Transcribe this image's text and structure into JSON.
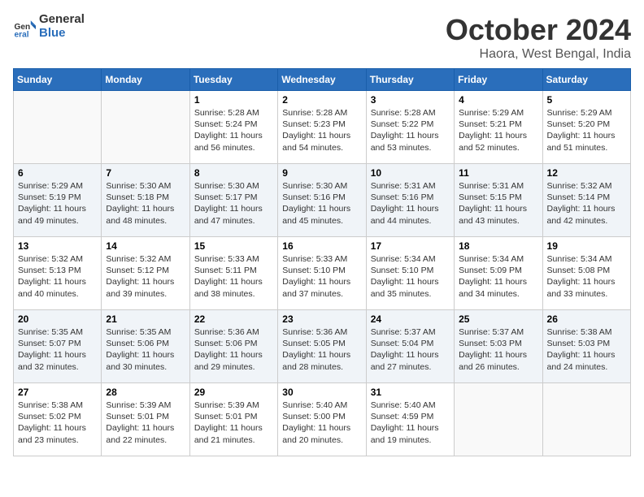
{
  "logo": {
    "line1": "General",
    "line2": "Blue"
  },
  "title": "October 2024",
  "location": "Haora, West Bengal, India",
  "days_of_week": [
    "Sunday",
    "Monday",
    "Tuesday",
    "Wednesday",
    "Thursday",
    "Friday",
    "Saturday"
  ],
  "weeks": [
    [
      {
        "day": "",
        "info": ""
      },
      {
        "day": "",
        "info": ""
      },
      {
        "day": "1",
        "info": "Sunrise: 5:28 AM\nSunset: 5:24 PM\nDaylight: 11 hours and 56 minutes."
      },
      {
        "day": "2",
        "info": "Sunrise: 5:28 AM\nSunset: 5:23 PM\nDaylight: 11 hours and 54 minutes."
      },
      {
        "day": "3",
        "info": "Sunrise: 5:28 AM\nSunset: 5:22 PM\nDaylight: 11 hours and 53 minutes."
      },
      {
        "day": "4",
        "info": "Sunrise: 5:29 AM\nSunset: 5:21 PM\nDaylight: 11 hours and 52 minutes."
      },
      {
        "day": "5",
        "info": "Sunrise: 5:29 AM\nSunset: 5:20 PM\nDaylight: 11 hours and 51 minutes."
      }
    ],
    [
      {
        "day": "6",
        "info": "Sunrise: 5:29 AM\nSunset: 5:19 PM\nDaylight: 11 hours and 49 minutes."
      },
      {
        "day": "7",
        "info": "Sunrise: 5:30 AM\nSunset: 5:18 PM\nDaylight: 11 hours and 48 minutes."
      },
      {
        "day": "8",
        "info": "Sunrise: 5:30 AM\nSunset: 5:17 PM\nDaylight: 11 hours and 47 minutes."
      },
      {
        "day": "9",
        "info": "Sunrise: 5:30 AM\nSunset: 5:16 PM\nDaylight: 11 hours and 45 minutes."
      },
      {
        "day": "10",
        "info": "Sunrise: 5:31 AM\nSunset: 5:16 PM\nDaylight: 11 hours and 44 minutes."
      },
      {
        "day": "11",
        "info": "Sunrise: 5:31 AM\nSunset: 5:15 PM\nDaylight: 11 hours and 43 minutes."
      },
      {
        "day": "12",
        "info": "Sunrise: 5:32 AM\nSunset: 5:14 PM\nDaylight: 11 hours and 42 minutes."
      }
    ],
    [
      {
        "day": "13",
        "info": "Sunrise: 5:32 AM\nSunset: 5:13 PM\nDaylight: 11 hours and 40 minutes."
      },
      {
        "day": "14",
        "info": "Sunrise: 5:32 AM\nSunset: 5:12 PM\nDaylight: 11 hours and 39 minutes."
      },
      {
        "day": "15",
        "info": "Sunrise: 5:33 AM\nSunset: 5:11 PM\nDaylight: 11 hours and 38 minutes."
      },
      {
        "day": "16",
        "info": "Sunrise: 5:33 AM\nSunset: 5:10 PM\nDaylight: 11 hours and 37 minutes."
      },
      {
        "day": "17",
        "info": "Sunrise: 5:34 AM\nSunset: 5:10 PM\nDaylight: 11 hours and 35 minutes."
      },
      {
        "day": "18",
        "info": "Sunrise: 5:34 AM\nSunset: 5:09 PM\nDaylight: 11 hours and 34 minutes."
      },
      {
        "day": "19",
        "info": "Sunrise: 5:34 AM\nSunset: 5:08 PM\nDaylight: 11 hours and 33 minutes."
      }
    ],
    [
      {
        "day": "20",
        "info": "Sunrise: 5:35 AM\nSunset: 5:07 PM\nDaylight: 11 hours and 32 minutes."
      },
      {
        "day": "21",
        "info": "Sunrise: 5:35 AM\nSunset: 5:06 PM\nDaylight: 11 hours and 30 minutes."
      },
      {
        "day": "22",
        "info": "Sunrise: 5:36 AM\nSunset: 5:06 PM\nDaylight: 11 hours and 29 minutes."
      },
      {
        "day": "23",
        "info": "Sunrise: 5:36 AM\nSunset: 5:05 PM\nDaylight: 11 hours and 28 minutes."
      },
      {
        "day": "24",
        "info": "Sunrise: 5:37 AM\nSunset: 5:04 PM\nDaylight: 11 hours and 27 minutes."
      },
      {
        "day": "25",
        "info": "Sunrise: 5:37 AM\nSunset: 5:03 PM\nDaylight: 11 hours and 26 minutes."
      },
      {
        "day": "26",
        "info": "Sunrise: 5:38 AM\nSunset: 5:03 PM\nDaylight: 11 hours and 24 minutes."
      }
    ],
    [
      {
        "day": "27",
        "info": "Sunrise: 5:38 AM\nSunset: 5:02 PM\nDaylight: 11 hours and 23 minutes."
      },
      {
        "day": "28",
        "info": "Sunrise: 5:39 AM\nSunset: 5:01 PM\nDaylight: 11 hours and 22 minutes."
      },
      {
        "day": "29",
        "info": "Sunrise: 5:39 AM\nSunset: 5:01 PM\nDaylight: 11 hours and 21 minutes."
      },
      {
        "day": "30",
        "info": "Sunrise: 5:40 AM\nSunset: 5:00 PM\nDaylight: 11 hours and 20 minutes."
      },
      {
        "day": "31",
        "info": "Sunrise: 5:40 AM\nSunset: 4:59 PM\nDaylight: 11 hours and 19 minutes."
      },
      {
        "day": "",
        "info": ""
      },
      {
        "day": "",
        "info": ""
      }
    ]
  ]
}
